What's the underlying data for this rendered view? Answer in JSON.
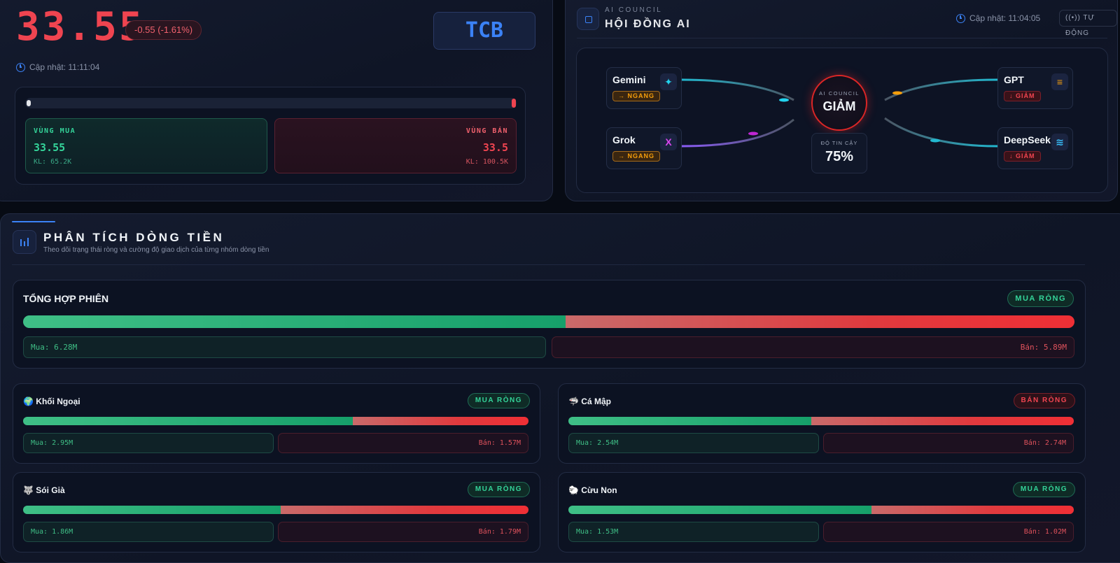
{
  "price_card": {
    "price": "33.55",
    "change": "-0.55 (-1.61%)",
    "ticker": "TCB",
    "update_label": "Cập nhật: 11:11:04",
    "buy_zone": {
      "title": "VÙNG MUA",
      "price": "33.55",
      "volume": "KL: 65.2K"
    },
    "sell_zone": {
      "title": "VÙNG BÁN",
      "price": "33.5",
      "volume": "KL: 100.5K"
    }
  },
  "ai_council": {
    "eyebrow": "AI COUNCIL",
    "title": "HỘI ĐỒNG AI",
    "update_label": "Cập nhật: 11:04:05",
    "auto_label": "((•)) TỰ ĐỘNG",
    "verdict_eyebrow": "AI COUNCIL",
    "verdict": "GIẢM",
    "confidence_label": "ĐỘ TIN CẬY",
    "confidence": "75%",
    "models": [
      {
        "name": "Gemini",
        "signal": "→ NGANG",
        "icon": "sparkle-icon",
        "glyph": "✦"
      },
      {
        "name": "Grok",
        "signal": "→ NGANG",
        "icon": "x-logo-icon",
        "glyph": "X"
      },
      {
        "name": "GPT",
        "signal": "↓ GIẢM",
        "icon": "chat-icon",
        "glyph": "≡"
      },
      {
        "name": "DeepSeek",
        "signal": "↓ GIẢM",
        "icon": "layers-icon",
        "glyph": "≋"
      }
    ]
  },
  "flow": {
    "title": "PHÂN TÍCH DÒNG TIỀN",
    "subtitle": "Theo dõi trạng thái ròng và cường độ giao dịch của từng nhóm dòng tiền",
    "session": {
      "title": "TỔNG HỢP PHIÊN",
      "status": "MUA RÒNG",
      "buy_label": "Mua: 6.28M",
      "sell_label": "Bán: 5.89M",
      "buy_value": 6.28,
      "sell_value": 5.89
    },
    "groups": [
      {
        "title": "🌍 Khối Ngoại",
        "status": "MUA RÒNG",
        "status_kind": "buy",
        "buy_label": "Mua: 2.95M",
        "sell_label": "Bán: 1.57M",
        "buy_value": 2.95,
        "sell_value": 1.57
      },
      {
        "title": "🦈 Cá Mập",
        "status": "BÁN RÒNG",
        "status_kind": "sell",
        "buy_label": "Mua: 2.54M",
        "sell_label": "Bán: 2.74M",
        "buy_value": 2.54,
        "sell_value": 2.74
      },
      {
        "title": "🐺 Sói Già",
        "status": "MUA RÒNG",
        "status_kind": "buy",
        "buy_label": "Mua: 1.86M",
        "sell_label": "Bán: 1.79M",
        "buy_value": 1.86,
        "sell_value": 1.79
      },
      {
        "title": "🐑 Cừu Non",
        "status": "MUA RÒNG",
        "status_kind": "buy",
        "buy_label": "Mua: 1.53M",
        "sell_label": "Bán: 1.02M",
        "buy_value": 1.53,
        "sell_value": 1.02
      }
    ]
  },
  "colors": {
    "buy": "#3fbf86",
    "sell": "#ef4450",
    "accent": "#3b82f6",
    "neutral": "#f59e0b"
  }
}
